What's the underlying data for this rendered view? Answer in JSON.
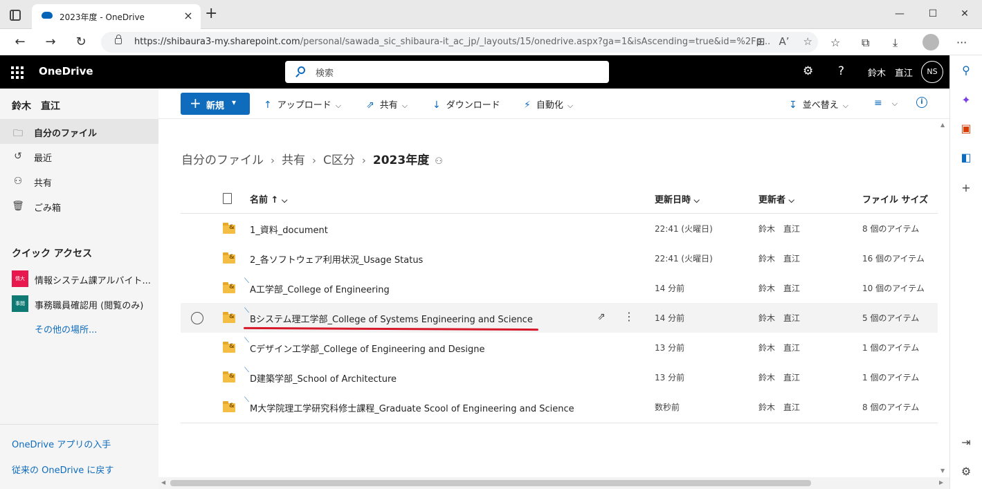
{
  "browser": {
    "tab_title": "2023年度 - OneDrive",
    "url_host": "https://shibaura3-my.sharepoint.com",
    "url_path": "/personal/sawada_sic_shibaura-it_ac_jp/_layouts/15/onedrive.aspx?ga=1&isAscending=true&id=%2Fp...",
    "reading_mode": "Aʼ"
  },
  "header": {
    "brand": "OneDrive",
    "search_placeholder": "検索",
    "user_name": "鈴木　直江",
    "avatar_initials": "NS"
  },
  "sidebar": {
    "user_name": "鈴木　直江",
    "items": [
      {
        "label": "自分のファイル",
        "icon": "folder-icon",
        "active": true
      },
      {
        "label": "最近",
        "icon": "history-icon"
      },
      {
        "label": "共有",
        "icon": "people-icon"
      },
      {
        "label": "ごみ箱",
        "icon": "trash-icon"
      }
    ],
    "quick_access_title": "クイック アクセス",
    "quick_access": [
      {
        "label": "情報システム課アルバイト...",
        "badge": "情大",
        "color": "#e8174d"
      },
      {
        "label": "事務職員確認用 (閲覧のみ)",
        "badge": "事閲",
        "color": "#0e7a73"
      }
    ],
    "more_places": "その他の場所...",
    "get_app": "OneDrive アプリの入手",
    "classic": "従来の OneDrive に戻す"
  },
  "commands": {
    "new": "新規",
    "upload": "アップロード",
    "share": "共有",
    "download": "ダウンロード",
    "automate": "自動化",
    "sort": "並べ替え"
  },
  "breadcrumb": [
    "自分のファイル",
    "共有",
    "C区分",
    "2023年度"
  ],
  "columns": {
    "name": "名前 ↑",
    "modified": "更新日時",
    "modified_by": "更新者",
    "size": "ファイル サイズ"
  },
  "files": [
    {
      "name": "1_資料_document",
      "modified": "22:41 (火曜日)",
      "by": "鈴木　直江",
      "size": "8 個のアイテム",
      "new": false
    },
    {
      "name": "2_各ソフトウェア利用状況_Usage Status",
      "modified": "22:41 (火曜日)",
      "by": "鈴木　直江",
      "size": "16 個のアイテム",
      "new": false
    },
    {
      "name": "A工学部_College of Engineering",
      "modified": "14 分前",
      "by": "鈴木　直江",
      "size": "10 個のアイテム",
      "new": true
    },
    {
      "name": "Bシステム理工学部_College of Systems Engineering and Science",
      "modified": "14 分前",
      "by": "鈴木　直江",
      "size": "5 個のアイテム",
      "new": true
    },
    {
      "name": "Cデザイン工学部_College of Engineering and Designe",
      "modified": "13 分前",
      "by": "鈴木　直江",
      "size": "1 個のアイテム",
      "new": true
    },
    {
      "name": "D建築学部_School of Architecture",
      "modified": "13 分前",
      "by": "鈴木　直江",
      "size": "1 個のアイテム",
      "new": true
    },
    {
      "name": "M大学院理工学研究科修士課程_Graduate Scool of Engineering and Science",
      "modified": "数秒前",
      "by": "鈴木　直江",
      "size": "8 個のアイテム",
      "new": true
    }
  ],
  "colors": {
    "accent": "#0f6cbd",
    "header_bg": "#000000",
    "highlight_underline": "#d6182a"
  }
}
